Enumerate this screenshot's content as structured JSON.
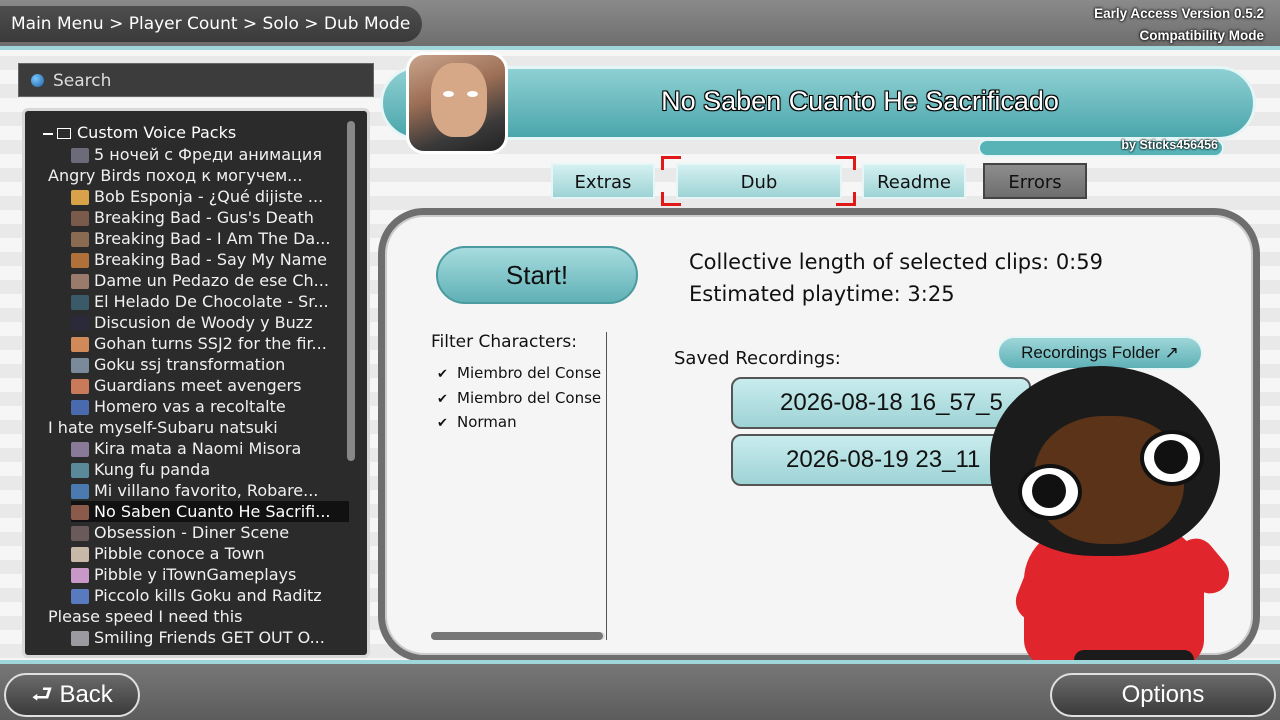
{
  "breadcrumb": "Main Menu > Player Count > Solo > Dub Mode",
  "version": {
    "line1": "Early Access Version 0.5.2",
    "line2": "Compatibility Mode"
  },
  "search": {
    "placeholder": "Search"
  },
  "tree": {
    "root_label": "Custom Voice Packs",
    "items": [
      {
        "label": "5 ночей с Фреди анимация",
        "icon": "thumb",
        "color": "#6b6b7a"
      },
      {
        "label": "Angry Birds поход к могучем...",
        "icon": "none"
      },
      {
        "label": "Bob Esponja - ¿Qué dijiste ...",
        "icon": "thumb",
        "color": "#d7a24a"
      },
      {
        "label": "Breaking Bad - Gus's Death",
        "icon": "thumb",
        "color": "#7a5a4a"
      },
      {
        "label": "Breaking Bad - I Am The Da...",
        "icon": "thumb",
        "color": "#8a6b52"
      },
      {
        "label": "Breaking Bad - Say My Name",
        "icon": "thumb",
        "color": "#b0703a"
      },
      {
        "label": "Dame un Pedazo de ese Ch...",
        "icon": "thumb",
        "color": "#9a7a6a"
      },
      {
        "label": "El Helado De Chocolate - Sr...",
        "icon": "thumb",
        "color": "#3a5a6a"
      },
      {
        "label": "Discusion de Woody y Buzz",
        "icon": "thumb",
        "color": "#2a2a3a"
      },
      {
        "label": "Gohan turns SSJ2 for the fir...",
        "icon": "thumb",
        "color": "#d08a5a"
      },
      {
        "label": "Goku ssj transformation",
        "icon": "thumb",
        "color": "#7a8a9a"
      },
      {
        "label": "Guardians meet avengers",
        "icon": "thumb",
        "color": "#c87a5a"
      },
      {
        "label": "Homero vas a recoltalte",
        "icon": "thumb",
        "color": "#4a6ab0"
      },
      {
        "label": "I hate myself-Subaru natsuki",
        "icon": "none"
      },
      {
        "label": "Kira mata a Naomi Misora",
        "icon": "thumb",
        "color": "#8a7a9a"
      },
      {
        "label": "Kung fu panda",
        "icon": "thumb",
        "color": "#5a8a9a"
      },
      {
        "label": "Mi villano favorito, Robare...",
        "icon": "thumb",
        "color": "#4a7ab0"
      },
      {
        "label": "No Saben Cuanto He Sacrifi...",
        "icon": "thumb",
        "color": "#8a5a4a",
        "selected": true
      },
      {
        "label": "Obsession - Diner Scene",
        "icon": "thumb",
        "color": "#6a5a5a"
      },
      {
        "label": "Pibble conoce a Town",
        "icon": "thumb",
        "color": "#c8b8a8"
      },
      {
        "label": "Pibble y iTownGameplays",
        "icon": "thumb",
        "color": "#c898c8"
      },
      {
        "label": "Piccolo kills Goku and Raditz",
        "icon": "thumb",
        "color": "#5a7ac0"
      },
      {
        "label": "Please speed I need this",
        "icon": "none"
      },
      {
        "label": "Smiling Friends GET OUT O...",
        "icon": "thumb",
        "color": "#9a9aa0"
      }
    ]
  },
  "pack": {
    "title": "No Saben Cuanto He Sacrificado",
    "author": "by Sticks456456"
  },
  "tabs": {
    "extras": "Extras",
    "dub": "Dub",
    "readme": "Readme",
    "errors": "Errors"
  },
  "main": {
    "start_label": "Start!",
    "stat1": "Collective length of selected clips:  0:59",
    "stat2": "Estimated playtime:  3:25",
    "filter_title": "Filter Characters:",
    "filters": [
      {
        "label": "Miembro del Conse",
        "checked": true
      },
      {
        "label": "Miembro del Conse",
        "checked": true
      },
      {
        "label": "Norman",
        "checked": true
      }
    ],
    "saved_title": "Saved Recordings:",
    "folder_label": "Recordings Folder ↗",
    "recordings": [
      "2026-08-18 16_57_5",
      "2026-08-19 23_11"
    ]
  },
  "footer": {
    "back_label": "⮐ Back",
    "options_label": "Options"
  },
  "colors": {
    "accent": "#5fb1b6",
    "selection": "#e01818"
  }
}
